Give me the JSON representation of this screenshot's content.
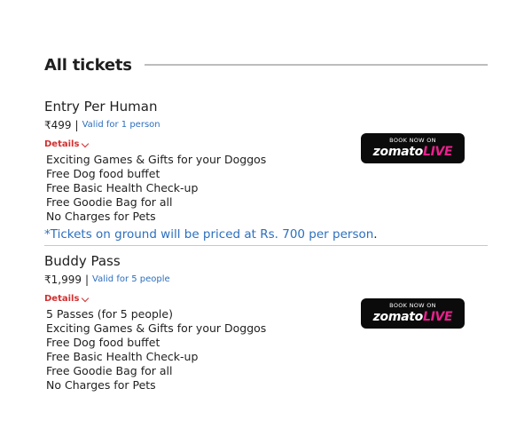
{
  "section": {
    "title": "All tickets"
  },
  "tickets": [
    {
      "name": "Entry Per Human",
      "price": "₹499",
      "separator": "|",
      "validity": "Valid for 1 person",
      "details_label": "Details",
      "features": [
        "Exciting Games & Gifts for your Doggos",
        "Free Dog food buffet",
        "Free Basic Health Check-up",
        "Free Goodie Bag for all",
        "No Charges for Pets"
      ],
      "note": "*Tickets on ground will be priced at Rs. 700 per person",
      "note_end": ".",
      "button": {
        "caption": "BOOK NOW ON",
        "logo_main": "zomato",
        "logo_live": "LIVE"
      }
    },
    {
      "name": "Buddy Pass",
      "price": "₹1,999",
      "separator": "|",
      "validity": "Valid for 5 people",
      "details_label": "Details",
      "features": [
        "5 Passes (for 5 people)",
        "Exciting Games & Gifts for your Doggos",
        "Free Dog food buffet",
        "Free Basic Health Check-up",
        "Free Goodie Bag for all",
        "No Charges for Pets"
      ],
      "button": {
        "caption": "BOOK NOW ON",
        "logo_main": "zomato",
        "logo_live": "LIVE"
      }
    }
  ],
  "colors": {
    "accent_blue": "#2c6fbf",
    "details_red": "#d32f2f",
    "button_bg": "#0b0b0b",
    "live_pink": "#e8218c"
  }
}
